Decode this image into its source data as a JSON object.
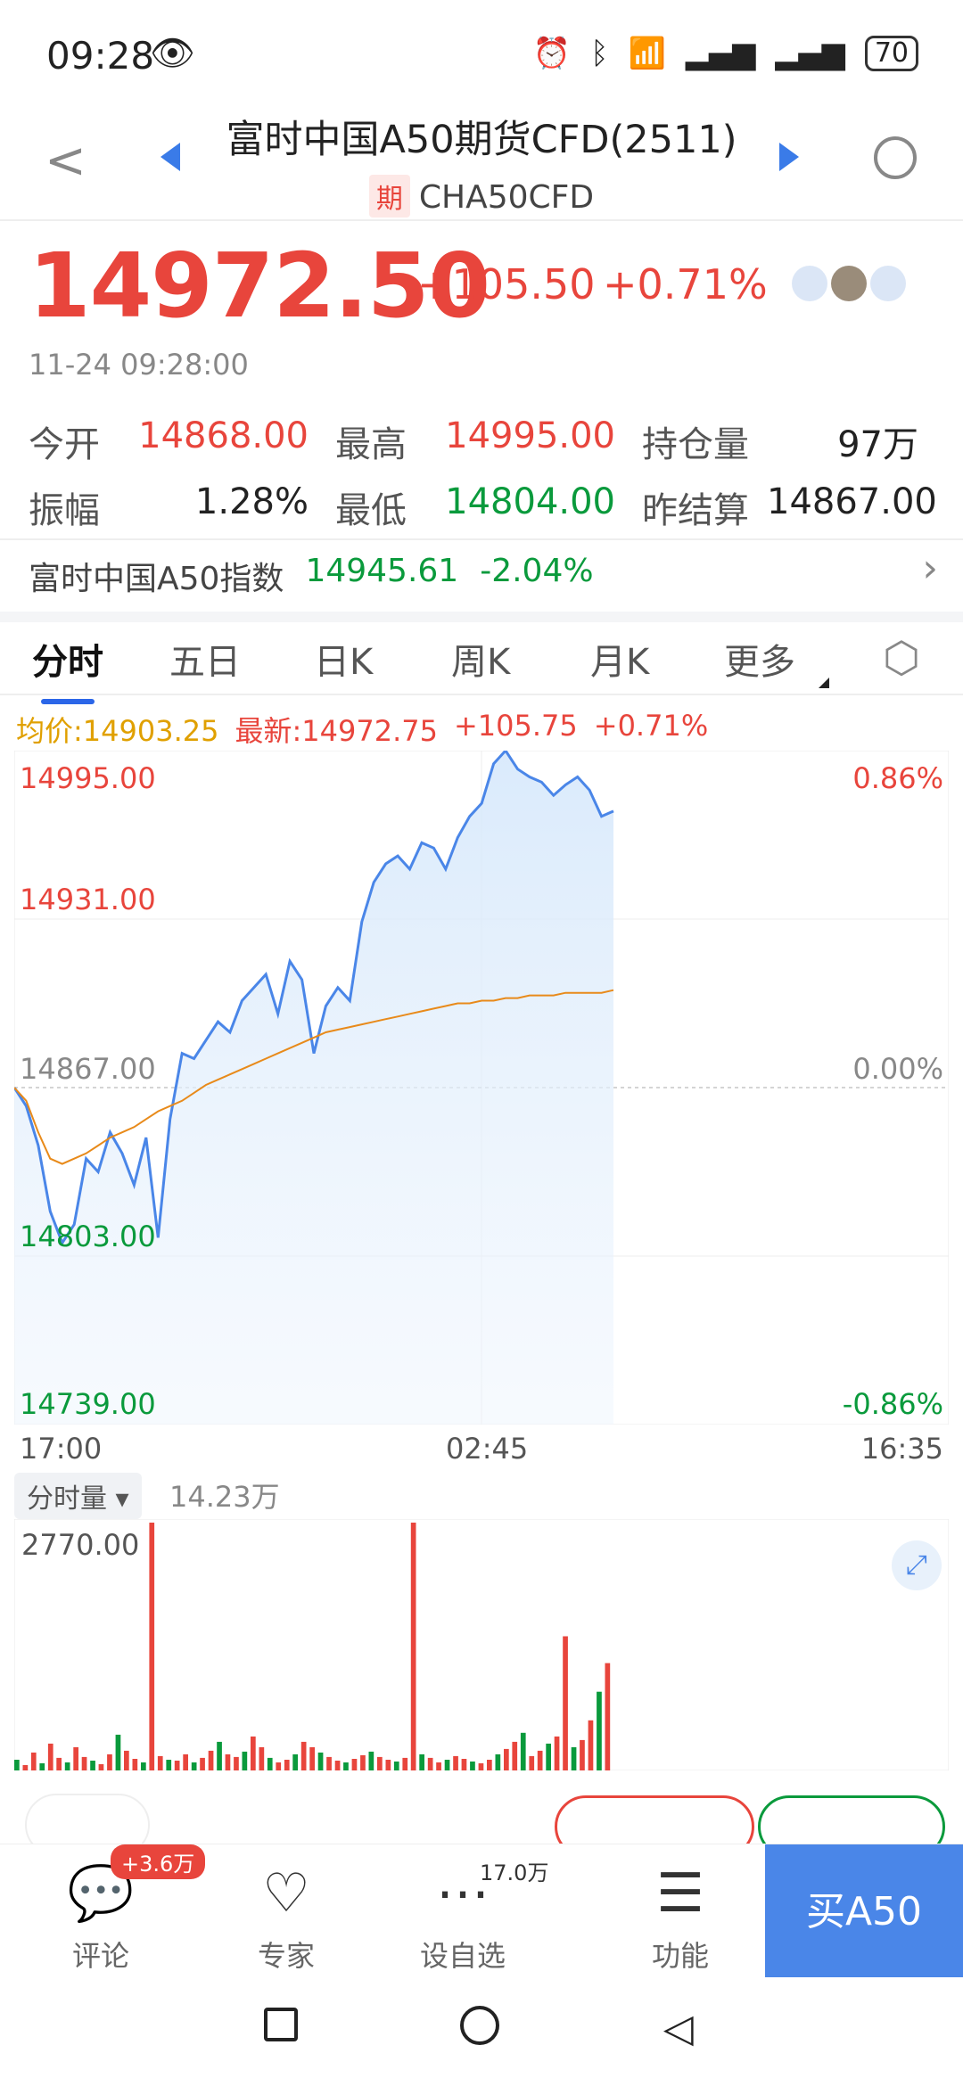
{
  "status_bar": {
    "time": "09:28",
    "battery": "70"
  },
  "header": {
    "title": "富时中国A50期货CFD(2511)",
    "tag": "期",
    "code": "CHA50CFD"
  },
  "quote": {
    "price": "14972.50",
    "change": "+105.50",
    "change_pct": "+0.71%",
    "datetime": "11-24 09:28:00"
  },
  "stats": {
    "open_label": "今开",
    "open": "14868.00",
    "high_label": "最高",
    "high": "14995.00",
    "oi_label": "持仓量",
    "oi": "97万",
    "amp_label": "振幅",
    "amp": "1.28%",
    "low_label": "最低",
    "low": "14804.00",
    "settle_label": "昨结算",
    "settle": "14867.00"
  },
  "index": {
    "name": "富时中国A50指数",
    "value": "14945.61",
    "change_pct": "-2.04%"
  },
  "tabs": [
    "分时",
    "五日",
    "日K",
    "周K",
    "月K",
    "更多"
  ],
  "chart_legend": {
    "avg": "均价:14903.25",
    "latest": "最新:14972.75",
    "change": "+105.75",
    "change_pct": "+0.71%"
  },
  "chart_data": {
    "type": "line",
    "y_ticks_left": [
      "14995.00",
      "14931.00",
      "14867.00",
      "14803.00",
      "14739.00"
    ],
    "y_ticks_right": [
      "0.86%",
      "0.00%",
      "-0.86%"
    ],
    "x_ticks": [
      "17:00",
      "02:45",
      "16:35"
    ],
    "ylim": [
      14739,
      14995
    ],
    "series": [
      {
        "values": [
          14867,
          14860,
          14845,
          14820,
          14808,
          14815,
          14840,
          14835,
          14850,
          14842,
          14830,
          14848,
          14810,
          14855,
          14880,
          14878,
          14885,
          14892,
          14888,
          14900,
          14905,
          14910,
          14895,
          14915,
          14908,
          14880,
          14898,
          14905,
          14900,
          14930,
          14945,
          14952,
          14955,
          14950,
          14960,
          14958,
          14950,
          14962,
          14970,
          14975,
          14990,
          14995,
          14988,
          14985,
          14983,
          14978,
          14982,
          14985,
          14980,
          14970,
          14972
        ]
      },
      {
        "values": [
          14867,
          14862,
          14850,
          14840,
          14838,
          14840,
          14842,
          14845,
          14848,
          14850,
          14852,
          14855,
          14858,
          14860,
          14862,
          14865,
          14868,
          14870,
          14872,
          14874,
          14876,
          14878,
          14880,
          14882,
          14884,
          14886,
          14888,
          14889,
          14890,
          14891,
          14892,
          14893,
          14894,
          14895,
          14896,
          14897,
          14898,
          14899,
          14899,
          14900,
          14900,
          14901,
          14901,
          14902,
          14902,
          14902,
          14903,
          14903,
          14903,
          14903,
          14904
        ]
      }
    ]
  },
  "volume": {
    "label": "分时量",
    "total": "14.23万",
    "max": "2770.00"
  },
  "volume_data": {
    "type": "bar",
    "values": [
      120,
      60,
      200,
      80,
      300,
      140,
      90,
      260,
      150,
      110,
      70,
      180,
      400,
      220,
      130,
      90,
      2770,
      160,
      120,
      110,
      180,
      90,
      140,
      220,
      320,
      180,
      150,
      210,
      380,
      260,
      140,
      90,
      120,
      180,
      320,
      260,
      200,
      150,
      110,
      90,
      130,
      170,
      210,
      150,
      120,
      100,
      140,
      2770,
      180,
      140,
      90,
      120,
      160,
      130,
      100,
      80,
      120,
      180,
      240,
      320,
      420,
      160,
      220,
      300,
      380,
      1500,
      260,
      340,
      560,
      880,
      1200
    ]
  },
  "bottom_bar": {
    "comment": "评论",
    "comment_badge": "+3.6万",
    "expert": "专家",
    "watch": "设自选",
    "watch_count": "17.0万",
    "func": "功能",
    "buy": "买A50"
  }
}
